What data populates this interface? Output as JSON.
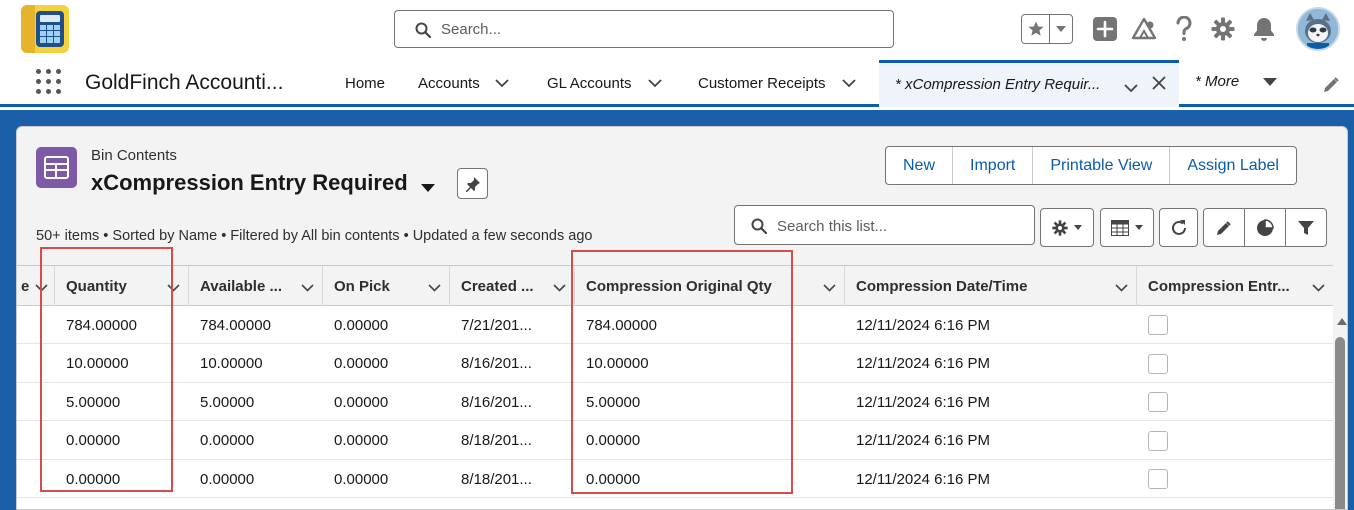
{
  "header": {
    "search_placeholder": "Search...",
    "icons": [
      "favorites-star-icon",
      "add-icon",
      "trailhead-icon",
      "help-icon",
      "setup-gear-icon",
      "notifications-bell-icon"
    ]
  },
  "nav": {
    "app_name": "GoldFinch Accounti...",
    "items": [
      {
        "label": "Home"
      },
      {
        "label": "Accounts"
      },
      {
        "label": "GL Accounts"
      },
      {
        "label": "Customer Receipts"
      }
    ],
    "active_tab": "* xCompression Entry Requir...",
    "more_label": "* More"
  },
  "list": {
    "object_type": "Bin Contents",
    "title": "xCompression Entry Required",
    "actions": [
      "New",
      "Import",
      "Printable View",
      "Assign Label"
    ],
    "status": "50+ items • Sorted by Name • Filtered by All bin contents • Updated a few seconds ago",
    "search_placeholder": "Search this list..."
  },
  "table": {
    "first_col_fragment": "e",
    "columns": [
      "Quantity",
      "Available ...",
      "On Pick",
      "Created ...",
      "Compression Original Qty",
      "Compression Date/Time",
      "Compression Entr..."
    ],
    "rows": [
      {
        "quantity": "784.00000",
        "available": "784.00000",
        "on_pick": "0.00000",
        "created": "7/21/201...",
        "orig_qty": "784.00000",
        "comp_dt": "12/11/2024 6:16 PM",
        "entry": false
      },
      {
        "quantity": "10.00000",
        "available": "10.00000",
        "on_pick": "0.00000",
        "created": "8/16/201...",
        "orig_qty": "10.00000",
        "comp_dt": "12/11/2024 6:16 PM",
        "entry": false
      },
      {
        "quantity": "5.00000",
        "available": "5.00000",
        "on_pick": "0.00000",
        "created": "8/16/201...",
        "orig_qty": "5.00000",
        "comp_dt": "12/11/2024 6:16 PM",
        "entry": false
      },
      {
        "quantity": "0.00000",
        "available": "0.00000",
        "on_pick": "0.00000",
        "created": "8/18/201...",
        "orig_qty": "0.00000",
        "comp_dt": "12/11/2024 6:16 PM",
        "entry": false
      },
      {
        "quantity": "0.00000",
        "available": "0.00000",
        "on_pick": "0.00000",
        "created": "8/18/201...",
        "orig_qty": "0.00000",
        "comp_dt": "12/11/2024 6:16 PM",
        "entry": false
      }
    ]
  },
  "colors": {
    "brand": "#0b5cab",
    "object_icon": "#7c5aa6",
    "highlight": "#d94a4a"
  }
}
